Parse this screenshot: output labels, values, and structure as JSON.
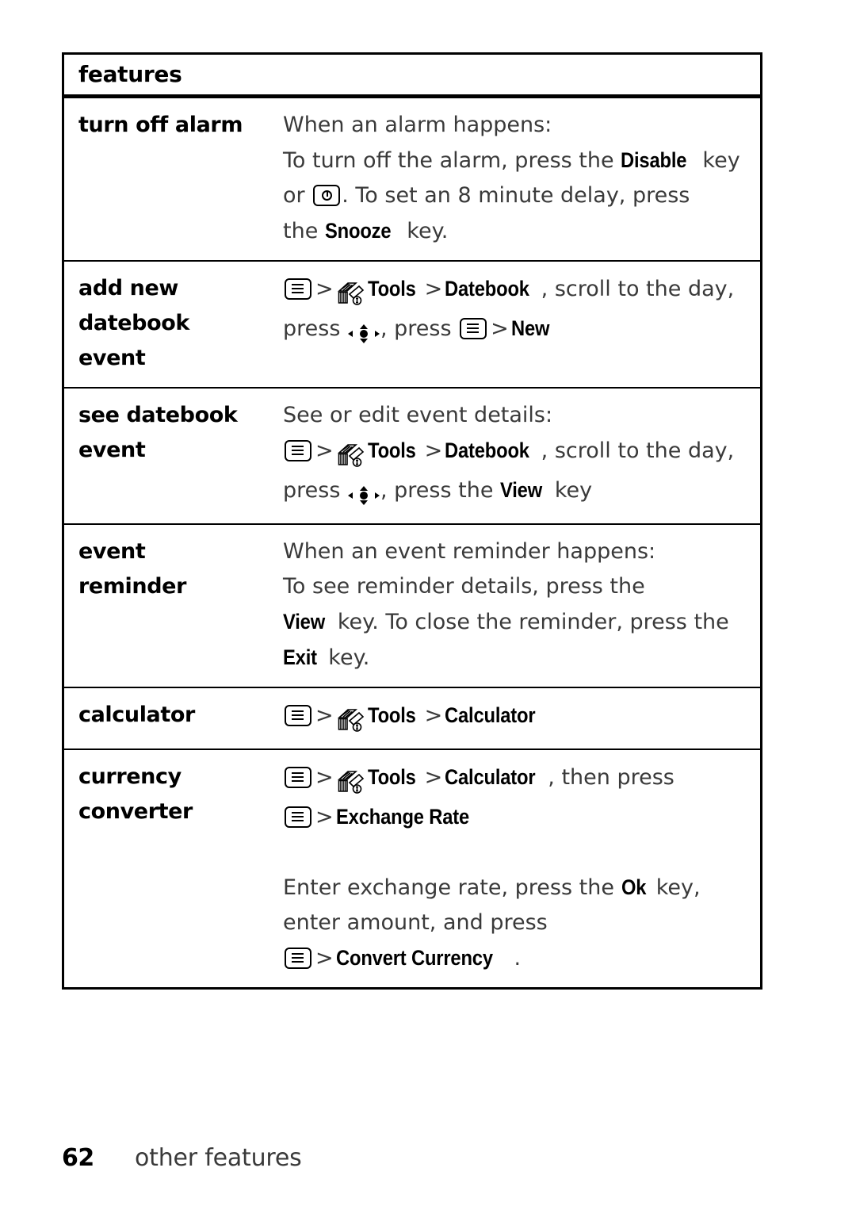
{
  "page": {
    "number": "62",
    "section_caption": "other features"
  },
  "table": {
    "header": "features",
    "rows": [
      {
        "term": "turn off alarm",
        "lines": [
          [
            {
              "t": "text",
              "v": "When an alarm happens:"
            }
          ],
          [
            {
              "t": "text",
              "v": "To turn off the alarm, press the "
            },
            {
              "t": "scr",
              "v": "Disable"
            },
            {
              "t": "text",
              "v": " key"
            }
          ],
          [
            {
              "t": "text",
              "v": "or "
            },
            {
              "t": "icon",
              "v": "power-key-icon"
            },
            {
              "t": "text",
              "v": ". To set an 8 minute delay, press"
            }
          ],
          [
            {
              "t": "text",
              "v": "the "
            },
            {
              "t": "scr",
              "v": "Snooze"
            },
            {
              "t": "text",
              "v": " key."
            }
          ]
        ]
      },
      {
        "term": "add new datebook event",
        "term_lines": [
          "add new",
          "datebook",
          "event"
        ],
        "lines": [
          [
            {
              "t": "icon",
              "v": "menu-key-icon"
            },
            {
              "t": "gt",
              "v": ">"
            },
            {
              "t": "icon",
              "v": "tools-icon"
            },
            {
              "t": "scr",
              "v": "Tools"
            },
            {
              "t": "gt",
              "v": ">"
            },
            {
              "t": "scr",
              "v": "Datebook"
            },
            {
              "t": "text",
              "v": ", scroll to the day,"
            }
          ],
          [
            {
              "t": "text",
              "v": "press "
            },
            {
              "t": "icon",
              "v": "nav-key-icon"
            },
            {
              "t": "text",
              "v": ", press "
            },
            {
              "t": "icon",
              "v": "menu-key-icon"
            },
            {
              "t": "gt",
              "v": ">"
            },
            {
              "t": "scr",
              "v": "New"
            }
          ]
        ]
      },
      {
        "term": "see datebook event",
        "term_lines": [
          "see datebook",
          "event"
        ],
        "lines": [
          [
            {
              "t": "text",
              "v": "See or edit event details:"
            }
          ],
          [
            {
              "t": "icon",
              "v": "menu-key-icon"
            },
            {
              "t": "gt",
              "v": ">"
            },
            {
              "t": "icon",
              "v": "tools-icon"
            },
            {
              "t": "scr",
              "v": "Tools"
            },
            {
              "t": "gt",
              "v": ">"
            },
            {
              "t": "scr",
              "v": "Datebook"
            },
            {
              "t": "text",
              "v": ", scroll to the day,"
            }
          ],
          [
            {
              "t": "text",
              "v": "press "
            },
            {
              "t": "icon",
              "v": "nav-key-icon"
            },
            {
              "t": "text",
              "v": ", press the "
            },
            {
              "t": "scr",
              "v": "View"
            },
            {
              "t": "text",
              "v": " key"
            }
          ]
        ]
      },
      {
        "term": "event reminder",
        "term_lines": [
          "event",
          "reminder"
        ],
        "lines": [
          [
            {
              "t": "text",
              "v": "When an event reminder happens:"
            }
          ],
          [
            {
              "t": "text",
              "v": "To see reminder details, press the"
            }
          ],
          [
            {
              "t": "scr",
              "v": "View"
            },
            {
              "t": "text",
              "v": " key. To close the reminder, press the"
            }
          ],
          [
            {
              "t": "scr",
              "v": "Exit"
            },
            {
              "t": "text",
              "v": " key."
            }
          ]
        ]
      },
      {
        "term": "calculator",
        "term_lines": [
          "calculator"
        ],
        "lines": [
          [
            {
              "t": "icon",
              "v": "menu-key-icon"
            },
            {
              "t": "gt",
              "v": ">"
            },
            {
              "t": "icon",
              "v": "tools-icon"
            },
            {
              "t": "scr",
              "v": "Tools"
            },
            {
              "t": "gt",
              "v": ">"
            },
            {
              "t": "scr",
              "v": "Calculator"
            }
          ]
        ]
      },
      {
        "term": "currency converter",
        "term_lines": [
          "currency",
          "converter"
        ],
        "lines": [
          [
            {
              "t": "icon",
              "v": "menu-key-icon"
            },
            {
              "t": "gt",
              "v": ">"
            },
            {
              "t": "icon",
              "v": "tools-icon"
            },
            {
              "t": "scr",
              "v": "Tools"
            },
            {
              "t": "gt",
              "v": ">"
            },
            {
              "t": "scr",
              "v": "Calculator"
            },
            {
              "t": "text",
              "v": ", then press"
            }
          ],
          [
            {
              "t": "icon",
              "v": "menu-key-icon"
            },
            {
              "t": "gt",
              "v": ">"
            },
            {
              "t": "scr",
              "v": "Exchange Rate"
            }
          ],
          [
            {
              "t": "spacer",
              "v": ""
            }
          ],
          [
            {
              "t": "text",
              "v": "Enter exchange rate, press the "
            },
            {
              "t": "scr",
              "v": "Ok"
            },
            {
              "t": "text",
              "v": " key,"
            }
          ],
          [
            {
              "t": "text",
              "v": "enter amount, and press"
            }
          ],
          [
            {
              "t": "icon",
              "v": "menu-key-icon"
            },
            {
              "t": "gt",
              "v": ">"
            },
            {
              "t": "scr",
              "v": "Convert Currency"
            },
            {
              "t": "text",
              "v": "."
            }
          ]
        ]
      }
    ]
  }
}
